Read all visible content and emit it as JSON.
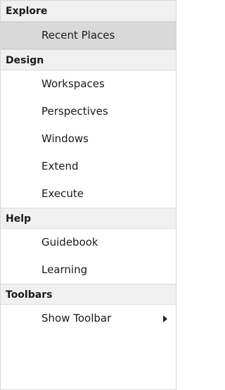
{
  "sections": [
    {
      "header": "Explore",
      "items": [
        {
          "label": "Recent Places",
          "highlighted": true
        }
      ]
    },
    {
      "header": "Design",
      "items": [
        {
          "label": "Workspaces"
        },
        {
          "label": "Perspectives"
        },
        {
          "label": "Windows"
        },
        {
          "label": "Extend"
        },
        {
          "label": "Execute"
        }
      ]
    },
    {
      "header": "Help",
      "items": [
        {
          "label": "Guidebook"
        },
        {
          "label": "Learning"
        }
      ]
    },
    {
      "header": "Toolbars",
      "items": [
        {
          "label": "Show Toolbar",
          "submenu_icon": "chevron-right-icon"
        }
      ]
    }
  ],
  "colors": {
    "header_background": "#f0f0f0",
    "highlight_background": "#d9d9d9",
    "text": "#1a1a1a"
  }
}
